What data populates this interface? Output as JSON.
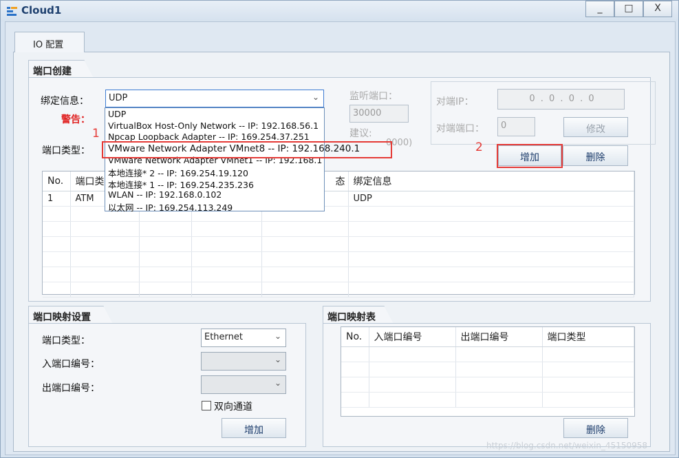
{
  "window": {
    "title": "Cloud1",
    "controls": {
      "minimize": "_",
      "maximize": "□",
      "close": "X"
    }
  },
  "tabs": [
    {
      "label": "IO 配置"
    }
  ],
  "port_creation": {
    "group_title": "端口创建",
    "binding_label": "绑定信息：",
    "binding_value": "UDP",
    "warning_label": "警告：",
    "port_type_label": "端口类型：",
    "listen_port_label": "监听端口：",
    "listen_port_value": "30000",
    "suggest_label": "建议:",
    "suggest_range_tail": "0000)",
    "peer_ip_label": "对端IP：",
    "peer_ip_value": "0 . 0 . 0 . 0",
    "peer_port_label": "对端端口：",
    "peer_port_value": "0",
    "modify_button": "修改",
    "add_button": "增加",
    "delete_button": "删除",
    "dropdown_options": [
      "UDP",
      "VirtualBox Host-Only Network -- IP: 192.168.56.1",
      "Npcap Loopback Adapter -- IP: 169.254.37.251",
      "VMware Network Adapter VMnet8 -- IP: 192.168.240.1",
      "VMware Network Adapter VMnet1 -- IP: 192.168.1",
      "本地连接* 2 -- IP: 169.254.19.120",
      "本地连接* 1 -- IP: 169.254.235.236",
      "WLAN -- IP: 192.168.0.102",
      "以太网 -- IP: 169.254.113.249"
    ],
    "table": {
      "headers": [
        "No.",
        "端口类",
        "",
        "",
        "态",
        "绑定信息"
      ],
      "rows": [
        [
          "1",
          "ATM",
          "",
          "",
          "",
          "UDP"
        ]
      ]
    }
  },
  "annotations": {
    "one": "1",
    "two": "2"
  },
  "port_mapping_settings": {
    "group_title": "端口映射设置",
    "port_type_label": "端口类型：",
    "port_type_value": "Ethernet",
    "in_port_label": "入端口编号：",
    "out_port_label": "出端口编号：",
    "bidirectional_label": "双向通道",
    "add_button": "增加"
  },
  "port_mapping_table": {
    "group_title": "端口映射表",
    "headers": [
      "No.",
      "入端口编号",
      "出端口编号",
      "端口类型"
    ],
    "delete_button": "删除"
  },
  "watermark": "https://blog.csdn.net/weixin_45150958",
  "colors": {
    "accent_red": "#e53935",
    "title_blue": "#1d3f6e"
  }
}
